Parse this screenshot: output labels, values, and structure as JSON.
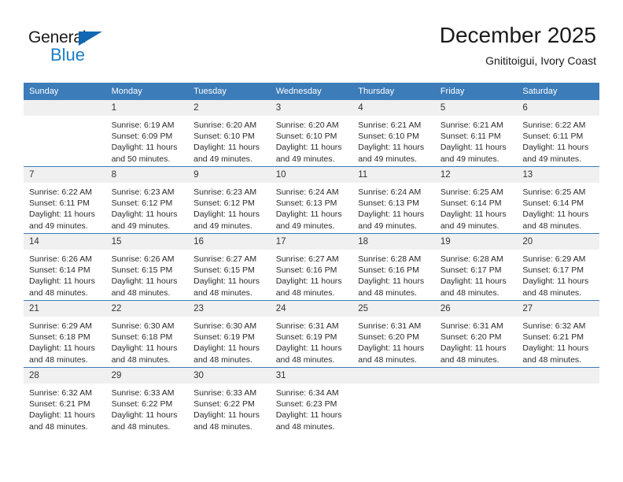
{
  "brand": {
    "name_top": "General",
    "name_bottom": "Blue",
    "triangle_icon": "blue-triangle-icon",
    "accent_color": "#1d7ec4"
  },
  "header": {
    "title": "December 2025",
    "subtitle": "Gnititoigui, Ivory Coast"
  },
  "calendar": {
    "header_bg": "#3c7cb9",
    "daynum_bg": "#f0f0f0",
    "weekdays": [
      "Sunday",
      "Monday",
      "Tuesday",
      "Wednesday",
      "Thursday",
      "Friday",
      "Saturday"
    ],
    "weeks": [
      [
        {
          "day": "",
          "empty": true,
          "sunrise": "",
          "sunset": "",
          "daylight1": "",
          "daylight2": ""
        },
        {
          "day": "1",
          "empty": false,
          "sunrise": "Sunrise: 6:19 AM",
          "sunset": "Sunset: 6:09 PM",
          "daylight1": "Daylight: 11 hours",
          "daylight2": "and 50 minutes."
        },
        {
          "day": "2",
          "empty": false,
          "sunrise": "Sunrise: 6:20 AM",
          "sunset": "Sunset: 6:10 PM",
          "daylight1": "Daylight: 11 hours",
          "daylight2": "and 49 minutes."
        },
        {
          "day": "3",
          "empty": false,
          "sunrise": "Sunrise: 6:20 AM",
          "sunset": "Sunset: 6:10 PM",
          "daylight1": "Daylight: 11 hours",
          "daylight2": "and 49 minutes."
        },
        {
          "day": "4",
          "empty": false,
          "sunrise": "Sunrise: 6:21 AM",
          "sunset": "Sunset: 6:10 PM",
          "daylight1": "Daylight: 11 hours",
          "daylight2": "and 49 minutes."
        },
        {
          "day": "5",
          "empty": false,
          "sunrise": "Sunrise: 6:21 AM",
          "sunset": "Sunset: 6:11 PM",
          "daylight1": "Daylight: 11 hours",
          "daylight2": "and 49 minutes."
        },
        {
          "day": "6",
          "empty": false,
          "sunrise": "Sunrise: 6:22 AM",
          "sunset": "Sunset: 6:11 PM",
          "daylight1": "Daylight: 11 hours",
          "daylight2": "and 49 minutes."
        }
      ],
      [
        {
          "day": "7",
          "empty": false,
          "sunrise": "Sunrise: 6:22 AM",
          "sunset": "Sunset: 6:11 PM",
          "daylight1": "Daylight: 11 hours",
          "daylight2": "and 49 minutes."
        },
        {
          "day": "8",
          "empty": false,
          "sunrise": "Sunrise: 6:23 AM",
          "sunset": "Sunset: 6:12 PM",
          "daylight1": "Daylight: 11 hours",
          "daylight2": "and 49 minutes."
        },
        {
          "day": "9",
          "empty": false,
          "sunrise": "Sunrise: 6:23 AM",
          "sunset": "Sunset: 6:12 PM",
          "daylight1": "Daylight: 11 hours",
          "daylight2": "and 49 minutes."
        },
        {
          "day": "10",
          "empty": false,
          "sunrise": "Sunrise: 6:24 AM",
          "sunset": "Sunset: 6:13 PM",
          "daylight1": "Daylight: 11 hours",
          "daylight2": "and 49 minutes."
        },
        {
          "day": "11",
          "empty": false,
          "sunrise": "Sunrise: 6:24 AM",
          "sunset": "Sunset: 6:13 PM",
          "daylight1": "Daylight: 11 hours",
          "daylight2": "and 49 minutes."
        },
        {
          "day": "12",
          "empty": false,
          "sunrise": "Sunrise: 6:25 AM",
          "sunset": "Sunset: 6:14 PM",
          "daylight1": "Daylight: 11 hours",
          "daylight2": "and 49 minutes."
        },
        {
          "day": "13",
          "empty": false,
          "sunrise": "Sunrise: 6:25 AM",
          "sunset": "Sunset: 6:14 PM",
          "daylight1": "Daylight: 11 hours",
          "daylight2": "and 48 minutes."
        }
      ],
      [
        {
          "day": "14",
          "empty": false,
          "sunrise": "Sunrise: 6:26 AM",
          "sunset": "Sunset: 6:14 PM",
          "daylight1": "Daylight: 11 hours",
          "daylight2": "and 48 minutes."
        },
        {
          "day": "15",
          "empty": false,
          "sunrise": "Sunrise: 6:26 AM",
          "sunset": "Sunset: 6:15 PM",
          "daylight1": "Daylight: 11 hours",
          "daylight2": "and 48 minutes."
        },
        {
          "day": "16",
          "empty": false,
          "sunrise": "Sunrise: 6:27 AM",
          "sunset": "Sunset: 6:15 PM",
          "daylight1": "Daylight: 11 hours",
          "daylight2": "and 48 minutes."
        },
        {
          "day": "17",
          "empty": false,
          "sunrise": "Sunrise: 6:27 AM",
          "sunset": "Sunset: 6:16 PM",
          "daylight1": "Daylight: 11 hours",
          "daylight2": "and 48 minutes."
        },
        {
          "day": "18",
          "empty": false,
          "sunrise": "Sunrise: 6:28 AM",
          "sunset": "Sunset: 6:16 PM",
          "daylight1": "Daylight: 11 hours",
          "daylight2": "and 48 minutes."
        },
        {
          "day": "19",
          "empty": false,
          "sunrise": "Sunrise: 6:28 AM",
          "sunset": "Sunset: 6:17 PM",
          "daylight1": "Daylight: 11 hours",
          "daylight2": "and 48 minutes."
        },
        {
          "day": "20",
          "empty": false,
          "sunrise": "Sunrise: 6:29 AM",
          "sunset": "Sunset: 6:17 PM",
          "daylight1": "Daylight: 11 hours",
          "daylight2": "and 48 minutes."
        }
      ],
      [
        {
          "day": "21",
          "empty": false,
          "sunrise": "Sunrise: 6:29 AM",
          "sunset": "Sunset: 6:18 PM",
          "daylight1": "Daylight: 11 hours",
          "daylight2": "and 48 minutes."
        },
        {
          "day": "22",
          "empty": false,
          "sunrise": "Sunrise: 6:30 AM",
          "sunset": "Sunset: 6:18 PM",
          "daylight1": "Daylight: 11 hours",
          "daylight2": "and 48 minutes."
        },
        {
          "day": "23",
          "empty": false,
          "sunrise": "Sunrise: 6:30 AM",
          "sunset": "Sunset: 6:19 PM",
          "daylight1": "Daylight: 11 hours",
          "daylight2": "and 48 minutes."
        },
        {
          "day": "24",
          "empty": false,
          "sunrise": "Sunrise: 6:31 AM",
          "sunset": "Sunset: 6:19 PM",
          "daylight1": "Daylight: 11 hours",
          "daylight2": "and 48 minutes."
        },
        {
          "day": "25",
          "empty": false,
          "sunrise": "Sunrise: 6:31 AM",
          "sunset": "Sunset: 6:20 PM",
          "daylight1": "Daylight: 11 hours",
          "daylight2": "and 48 minutes."
        },
        {
          "day": "26",
          "empty": false,
          "sunrise": "Sunrise: 6:31 AM",
          "sunset": "Sunset: 6:20 PM",
          "daylight1": "Daylight: 11 hours",
          "daylight2": "and 48 minutes."
        },
        {
          "day": "27",
          "empty": false,
          "sunrise": "Sunrise: 6:32 AM",
          "sunset": "Sunset: 6:21 PM",
          "daylight1": "Daylight: 11 hours",
          "daylight2": "and 48 minutes."
        }
      ],
      [
        {
          "day": "28",
          "empty": false,
          "sunrise": "Sunrise: 6:32 AM",
          "sunset": "Sunset: 6:21 PM",
          "daylight1": "Daylight: 11 hours",
          "daylight2": "and 48 minutes."
        },
        {
          "day": "29",
          "empty": false,
          "sunrise": "Sunrise: 6:33 AM",
          "sunset": "Sunset: 6:22 PM",
          "daylight1": "Daylight: 11 hours",
          "daylight2": "and 48 minutes."
        },
        {
          "day": "30",
          "empty": false,
          "sunrise": "Sunrise: 6:33 AM",
          "sunset": "Sunset: 6:22 PM",
          "daylight1": "Daylight: 11 hours",
          "daylight2": "and 48 minutes."
        },
        {
          "day": "31",
          "empty": false,
          "sunrise": "Sunrise: 6:34 AM",
          "sunset": "Sunset: 6:23 PM",
          "daylight1": "Daylight: 11 hours",
          "daylight2": "and 48 minutes."
        },
        {
          "day": "",
          "empty": true,
          "sunrise": "",
          "sunset": "",
          "daylight1": "",
          "daylight2": ""
        },
        {
          "day": "",
          "empty": true,
          "sunrise": "",
          "sunset": "",
          "daylight1": "",
          "daylight2": ""
        },
        {
          "day": "",
          "empty": true,
          "sunrise": "",
          "sunset": "",
          "daylight1": "",
          "daylight2": ""
        }
      ]
    ]
  }
}
